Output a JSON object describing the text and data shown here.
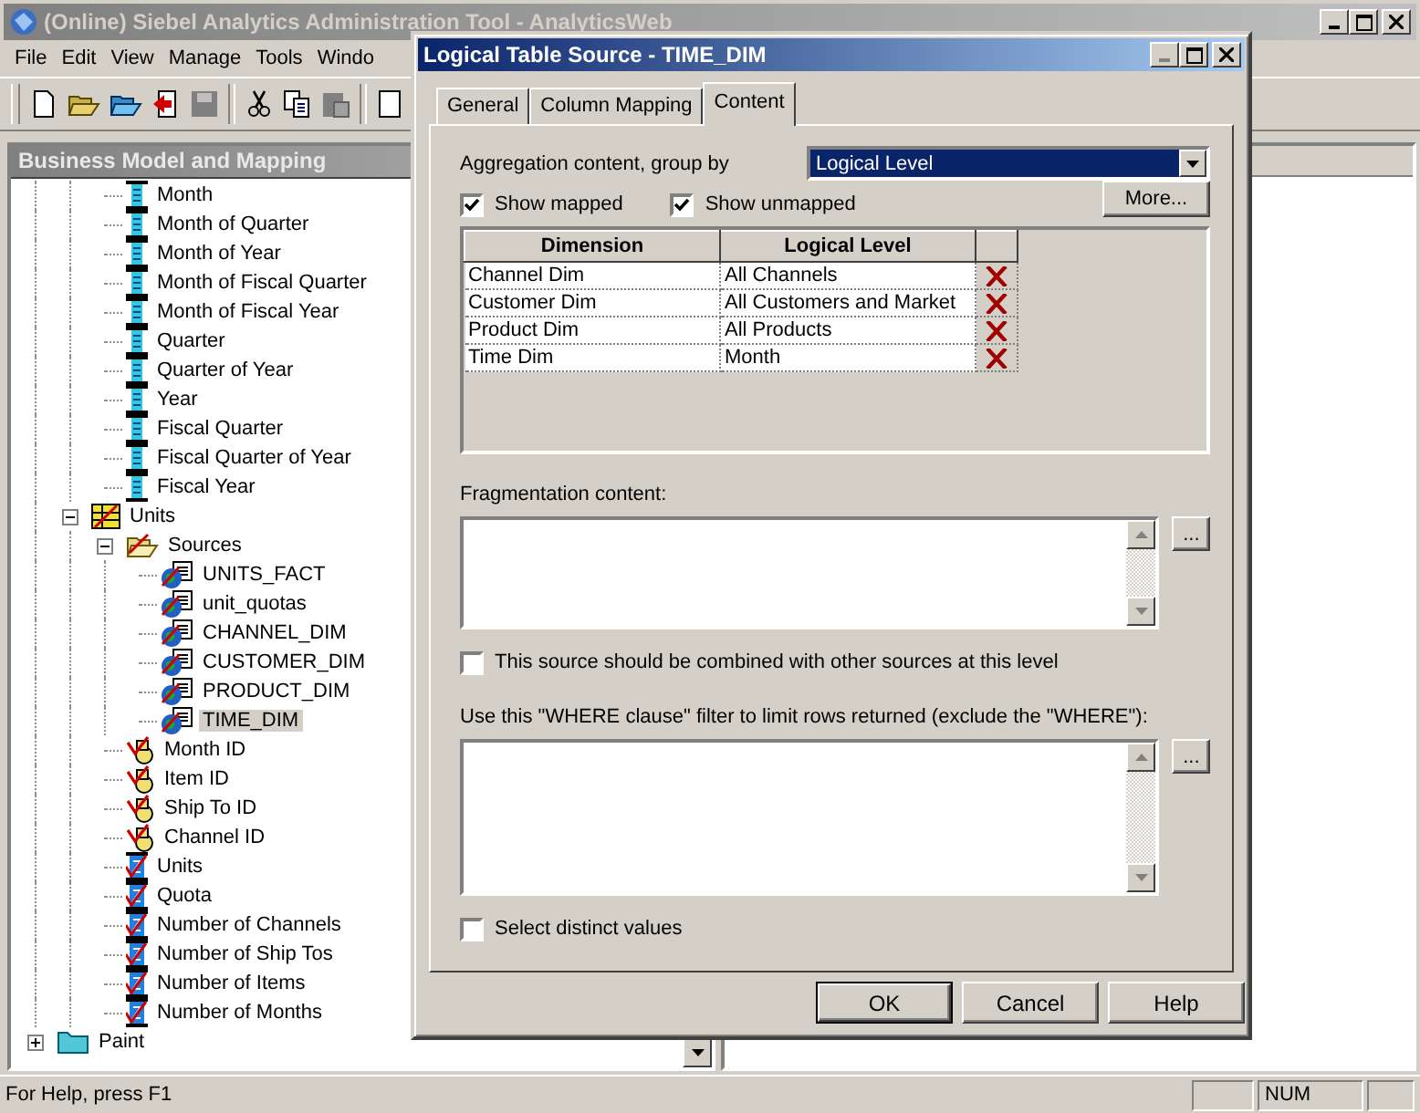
{
  "window": {
    "title": "(Online) Siebel Analytics Administration Tool - AnalyticsWeb"
  },
  "menu": [
    "File",
    "Edit",
    "View",
    "Manage",
    "Tools",
    "Windo"
  ],
  "pane_title": "Business Model and Mapping",
  "tree": [
    {
      "children": [
        {
          "children": [
            {
              "label": "Month",
              "kind": "level",
              "selected": false
            },
            {
              "label": "Month of Quarter",
              "kind": "level",
              "selected": false
            },
            {
              "label": "Month of Year",
              "kind": "level",
              "selected": false
            },
            {
              "label": "Month of Fiscal Quarter",
              "kind": "level",
              "selected": false
            },
            {
              "label": "Month of Fiscal Year",
              "kind": "level",
              "selected": false
            },
            {
              "label": "Quarter",
              "kind": "level",
              "selected": false
            },
            {
              "label": "Quarter of Year",
              "kind": "level",
              "selected": false
            },
            {
              "label": "Year",
              "kind": "level",
              "selected": false
            },
            {
              "label": "Fiscal Quarter",
              "kind": "level",
              "selected": false
            },
            {
              "label": "Fiscal Quarter of Year",
              "kind": "level",
              "selected": false
            },
            {
              "label": "Fiscal Year",
              "kind": "level",
              "selected": false
            }
          ]
        },
        {
          "label": "Units",
          "kind": "fact",
          "expanded": true,
          "selected": false,
          "children": [
            {
              "label": "Sources",
              "kind": "sources",
              "expanded": true,
              "selected": false,
              "children": [
                {
                  "label": "UNITS_FACT",
                  "kind": "source",
                  "selected": false
                },
                {
                  "label": "unit_quotas",
                  "kind": "source",
                  "selected": false
                },
                {
                  "label": "CHANNEL_DIM",
                  "kind": "source",
                  "selected": false
                },
                {
                  "label": "CUSTOMER_DIM",
                  "kind": "source",
                  "selected": false
                },
                {
                  "label": "PRODUCT_DIM",
                  "kind": "source",
                  "selected": false
                },
                {
                  "label": "TIME_DIM",
                  "kind": "source",
                  "selected": true
                }
              ]
            },
            {
              "label": "Month ID",
              "kind": "key",
              "selected": false
            },
            {
              "label": "Item ID",
              "kind": "key",
              "selected": false
            },
            {
              "label": "Ship To ID",
              "kind": "key",
              "selected": false
            },
            {
              "label": "Channel ID",
              "kind": "key",
              "selected": false
            },
            {
              "label": "Units",
              "kind": "measure",
              "selected": false
            },
            {
              "label": "Quota",
              "kind": "measure",
              "selected": false
            },
            {
              "label": "Number of Channels",
              "kind": "measure",
              "selected": false
            },
            {
              "label": "Number of Ship Tos",
              "kind": "measure",
              "selected": false
            },
            {
              "label": "Number of Items",
              "kind": "measure",
              "selected": false
            },
            {
              "label": "Number of Months",
              "kind": "measure",
              "selected": false
            }
          ]
        }
      ]
    },
    {
      "label": "Paint",
      "kind": "folder",
      "expanded": false,
      "selected": false
    }
  ],
  "status_bar": {
    "text": "For Help, press F1",
    "indicators": [
      "NUM"
    ]
  },
  "dialog": {
    "title": "Logical Table Source - TIME_DIM",
    "tabs": [
      {
        "label": "General",
        "selected": false
      },
      {
        "label": "Column Mapping",
        "selected": false
      },
      {
        "label": "Content",
        "selected": true
      }
    ],
    "aggregation": {
      "label": "Aggregation content, group by",
      "value": "Logical Level"
    },
    "show_options": [
      {
        "label": "Show mapped",
        "checked": true
      },
      {
        "label": "Show unmapped",
        "checked": true
      }
    ],
    "more_button": "More...",
    "table": {
      "columns": [
        "Dimension",
        "Logical Level"
      ],
      "rows": [
        [
          "Channel Dim",
          "All Channels"
        ],
        [
          "Customer Dim",
          "All Customers and Market"
        ],
        [
          "Product Dim",
          "All Products"
        ],
        [
          "Time Dim",
          "Month"
        ]
      ]
    },
    "fragmentation": {
      "label": "Fragmentation content:",
      "browse_button": "..."
    },
    "combine": {
      "label": "This source should be combined with other sources at this level",
      "checked": false
    },
    "where": {
      "label": "Use this \"WHERE clause\" filter to limit rows returned (exclude the \"WHERE\"):",
      "browse_button": "..."
    },
    "distinct": {
      "label": "Select distinct values",
      "checked": false
    },
    "buttons": [
      {
        "label": "OK",
        "default": true
      },
      {
        "label": "Cancel",
        "default": false
      },
      {
        "label": "Help",
        "default": false
      }
    ]
  }
}
